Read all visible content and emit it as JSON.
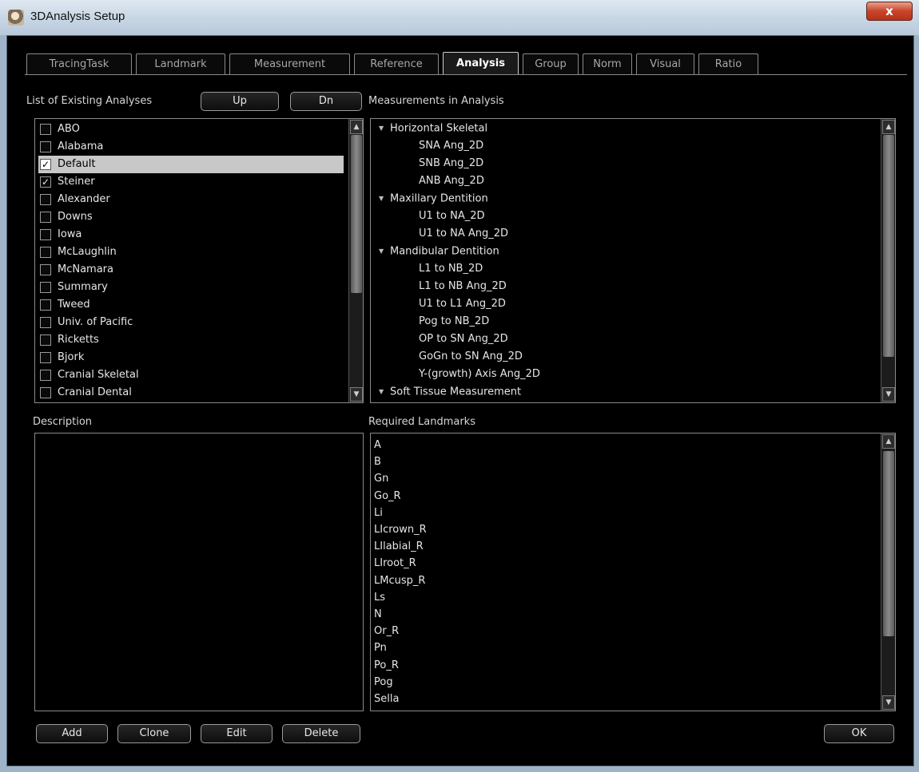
{
  "window": {
    "title": "3DAnalysis Setup",
    "close_label": "x"
  },
  "tabs": [
    {
      "label": "TracingTask"
    },
    {
      "label": "Landmark"
    },
    {
      "label": "Measurement"
    },
    {
      "label": "Reference"
    },
    {
      "label": "Analysis",
      "active": true
    },
    {
      "label": "Group"
    },
    {
      "label": "Norm"
    },
    {
      "label": "Visual"
    },
    {
      "label": "Ratio"
    }
  ],
  "analyses": {
    "label": "List of Existing Analyses",
    "up_label": "Up",
    "down_label": "Dn",
    "items": [
      {
        "label": "ABO",
        "checked": false
      },
      {
        "label": "Alabama",
        "checked": false
      },
      {
        "label": "Default",
        "checked": true,
        "selected": true
      },
      {
        "label": "Steiner",
        "checked": true
      },
      {
        "label": "Alexander",
        "checked": false
      },
      {
        "label": "Downs",
        "checked": false
      },
      {
        "label": "Iowa",
        "checked": false
      },
      {
        "label": "McLaughlin",
        "checked": false
      },
      {
        "label": "McNamara",
        "checked": false
      },
      {
        "label": "Summary",
        "checked": false
      },
      {
        "label": "Tweed",
        "checked": false
      },
      {
        "label": "Univ. of Pacific",
        "checked": false
      },
      {
        "label": "Ricketts",
        "checked": false
      },
      {
        "label": "Bjork",
        "checked": false
      },
      {
        "label": "Cranial Skeletal",
        "checked": false
      },
      {
        "label": "Cranial Dental",
        "checked": false
      }
    ]
  },
  "measurements": {
    "label": "Measurements in Analysis",
    "items": [
      {
        "label": "Horizontal Skeletal",
        "group": true
      },
      {
        "label": "SNA Ang_2D"
      },
      {
        "label": "SNB Ang_2D"
      },
      {
        "label": "ANB Ang_2D"
      },
      {
        "label": "Maxillary Dentition",
        "group": true
      },
      {
        "label": "U1 to NA_2D"
      },
      {
        "label": "U1 to NA Ang_2D"
      },
      {
        "label": "Mandibular Dentition",
        "group": true
      },
      {
        "label": "L1 to NB_2D"
      },
      {
        "label": "L1 to NB Ang_2D"
      },
      {
        "label": "U1 to L1 Ang_2D"
      },
      {
        "label": "Pog to NB_2D"
      },
      {
        "label": "OP to SN Ang_2D"
      },
      {
        "label": "GoGn to SN Ang_2D"
      },
      {
        "label": "Y-(growth) Axis Ang_2D"
      },
      {
        "label": "Soft Tissue Measurement",
        "group": true
      }
    ]
  },
  "description": {
    "label": "Description",
    "text": ""
  },
  "landmarks": {
    "label": "Required Landmarks",
    "items": [
      "A",
      "B",
      "Gn",
      "Go_R",
      "Li",
      "LIcrown_R",
      "LIlabial_R",
      "LIroot_R",
      "LMcusp_R",
      "Ls",
      "N",
      "Or_R",
      "Pn",
      "Po_R",
      "Pog",
      "Sella"
    ]
  },
  "buttons": {
    "add": "Add",
    "clone": "Clone",
    "edit": "Edit",
    "delete": "Delete",
    "ok": "OK"
  },
  "icons": {
    "scroll_up": "▲",
    "scroll_down": "▼",
    "expand": "▼",
    "check": "✓"
  }
}
